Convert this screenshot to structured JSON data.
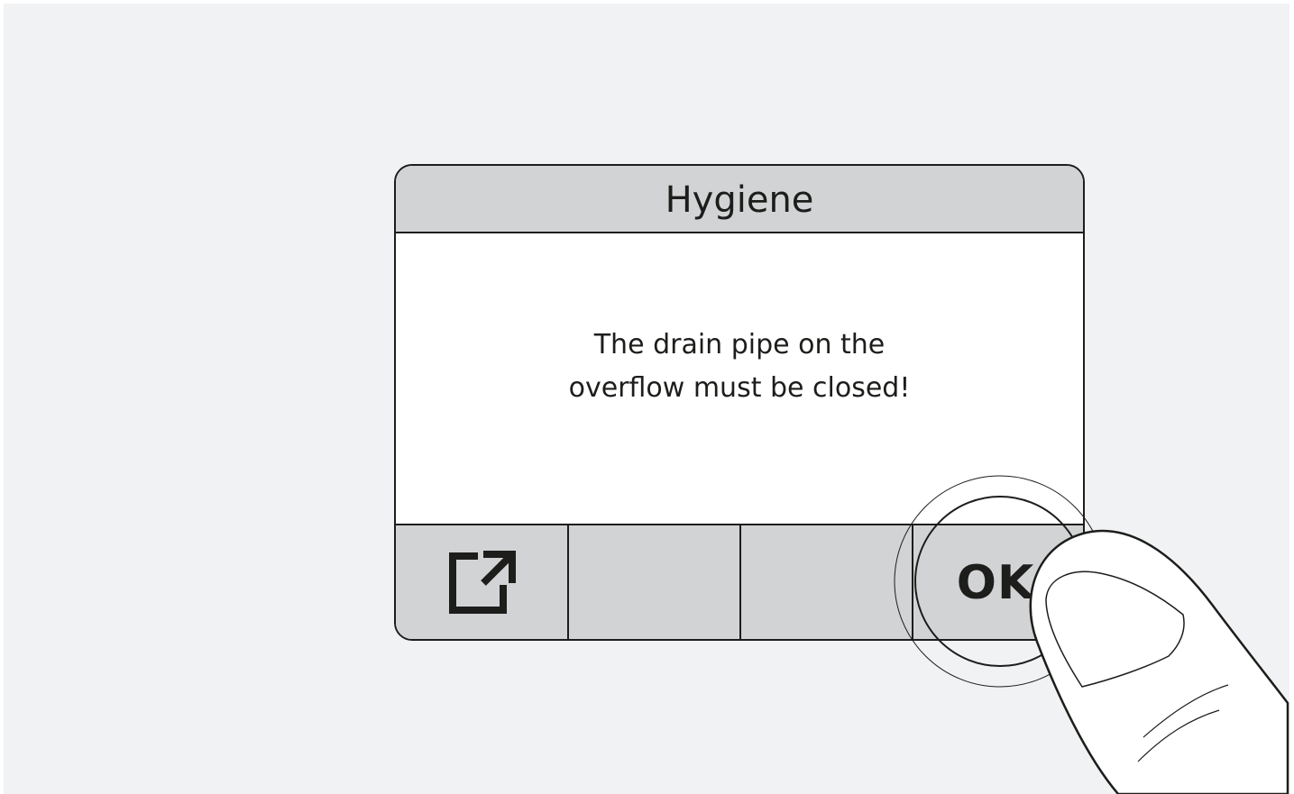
{
  "dialog": {
    "title": "Hygiene",
    "message_lines": [
      "The drain pipe on the",
      "overflow must be closed!"
    ]
  },
  "buttons": [
    {
      "icon": "export-icon",
      "label": ""
    },
    {
      "label": ""
    },
    {
      "label": ""
    },
    {
      "label": "OK"
    }
  ],
  "colors": {
    "background": "#f1f2f4",
    "bar": "#d2d3d5",
    "panel": "#ffffff",
    "ink": "#1d1d1b"
  },
  "overlay": {
    "hand_icon": "finger-pressing-icon",
    "highlight_icon": "press-ring-icon"
  }
}
